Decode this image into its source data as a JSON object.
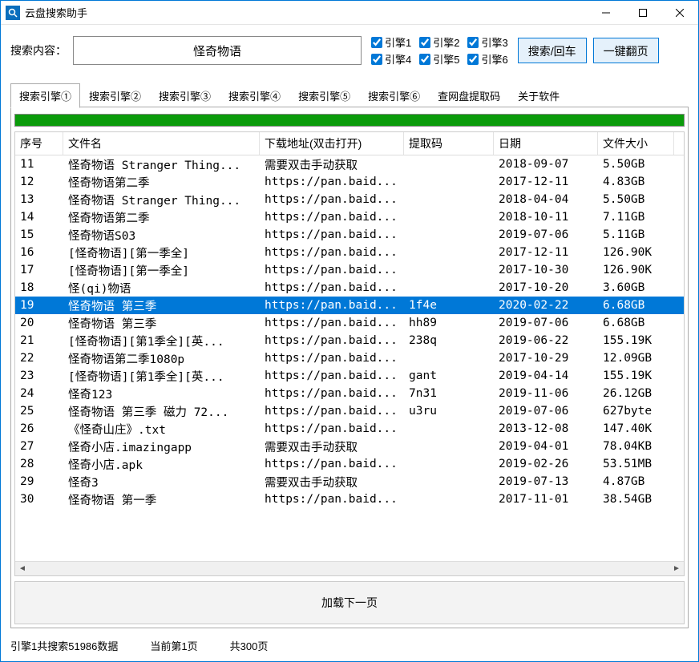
{
  "window": {
    "title": "云盘搜索助手"
  },
  "search": {
    "label": "搜索内容：",
    "value": "怪奇物语",
    "engines": [
      {
        "label": "引擎1",
        "checked": true
      },
      {
        "label": "引擎2",
        "checked": true
      },
      {
        "label": "引擎3",
        "checked": true
      },
      {
        "label": "引擎4",
        "checked": true
      },
      {
        "label": "引擎5",
        "checked": true
      },
      {
        "label": "引擎6",
        "checked": true
      }
    ],
    "search_btn": "搜索/回车",
    "page_btn": "一键翻页"
  },
  "tabs": [
    "搜索引擎①",
    "搜索引擎②",
    "搜索引擎③",
    "搜索引擎④",
    "搜索引擎⑤",
    "搜索引擎⑥",
    "查网盘提取码",
    "关于软件"
  ],
  "active_tab": 0,
  "columns": [
    "序号",
    "文件名",
    "下载地址(双击打开)",
    "提取码",
    "日期",
    "文件大小"
  ],
  "rows": [
    {
      "seq": "11",
      "name": "怪奇物语 Stranger Thing...",
      "url": "需要双击手动获取",
      "code": "",
      "date": "2018-09-07",
      "size": "5.50GB"
    },
    {
      "seq": "12",
      "name": "怪奇物语第二季",
      "url": "https://pan.baid...",
      "code": "",
      "date": "2017-12-11",
      "size": "4.83GB"
    },
    {
      "seq": "13",
      "name": "怪奇物语 Stranger Thing...",
      "url": "https://pan.baid...",
      "code": "",
      "date": "2018-04-04",
      "size": "5.50GB"
    },
    {
      "seq": "14",
      "name": "怪奇物语第二季",
      "url": "https://pan.baid...",
      "code": "",
      "date": "2018-10-11",
      "size": "7.11GB"
    },
    {
      "seq": "15",
      "name": "怪奇物语S03",
      "url": "https://pan.baid...",
      "code": "",
      "date": "2019-07-06",
      "size": "5.11GB"
    },
    {
      "seq": "16",
      "name": "[怪奇物语][第一季全]",
      "url": "https://pan.baid...",
      "code": "",
      "date": "2017-12-11",
      "size": "126.90K"
    },
    {
      "seq": "17",
      "name": "[怪奇物语][第一季全]",
      "url": "https://pan.baid...",
      "code": "",
      "date": "2017-10-30",
      "size": "126.90K"
    },
    {
      "seq": "18",
      "name": "怪(qi)物语",
      "url": "https://pan.baid...",
      "code": "",
      "date": "2017-10-20",
      "size": "3.60GB"
    },
    {
      "seq": "19",
      "name": "怪奇物语 第三季",
      "url": "https://pan.baid...",
      "code": "1f4e",
      "date": "2020-02-22",
      "size": "6.68GB",
      "selected": true
    },
    {
      "seq": "20",
      "name": "怪奇物语 第三季",
      "url": "https://pan.baid...",
      "code": "hh89",
      "date": "2019-07-06",
      "size": "6.68GB"
    },
    {
      "seq": "21",
      "name": "[怪奇物语][第1季全][英...",
      "url": "https://pan.baid...",
      "code": "238q",
      "date": "2019-06-22",
      "size": "155.19K"
    },
    {
      "seq": "22",
      "name": "怪奇物语第二季1080p",
      "url": "https://pan.baid...",
      "code": "",
      "date": "2017-10-29",
      "size": "12.09GB"
    },
    {
      "seq": "23",
      "name": "[怪奇物语][第1季全][英...",
      "url": "https://pan.baid...",
      "code": "gant",
      "date": "2019-04-14",
      "size": "155.19K"
    },
    {
      "seq": "24",
      "name": "怪奇123",
      "url": "https://pan.baid...",
      "code": "7n31",
      "date": "2019-11-06",
      "size": "26.12GB"
    },
    {
      "seq": "25",
      "name": "怪奇物语 第三季 磁力 72...",
      "url": "https://pan.baid...",
      "code": "u3ru",
      "date": "2019-07-06",
      "size": "627byte"
    },
    {
      "seq": "26",
      "name": "《怪奇山庄》.txt",
      "url": "https://pan.baid...",
      "code": "",
      "date": "2013-12-08",
      "size": "147.40K"
    },
    {
      "seq": "27",
      "name": "怪奇小店.imazingapp",
      "url": "需要双击手动获取",
      "code": "",
      "date": "2019-04-01",
      "size": "78.04KB"
    },
    {
      "seq": "28",
      "name": "怪奇小店.apk",
      "url": "https://pan.baid...",
      "code": "",
      "date": "2019-02-26",
      "size": "53.51MB"
    },
    {
      "seq": "29",
      "name": "怪奇3",
      "url": "需要双击手动获取",
      "code": "",
      "date": "2019-07-13",
      "size": "4.87GB"
    },
    {
      "seq": "30",
      "name": "怪奇物语 第一季",
      "url": "https://pan.baid...",
      "code": "",
      "date": "2017-11-01",
      "size": "38.54GB"
    }
  ],
  "load_next": "加载下一页",
  "status": {
    "count": "引擎1共搜索51986数据",
    "current_page": "当前第1页",
    "total_pages": "共300页"
  }
}
